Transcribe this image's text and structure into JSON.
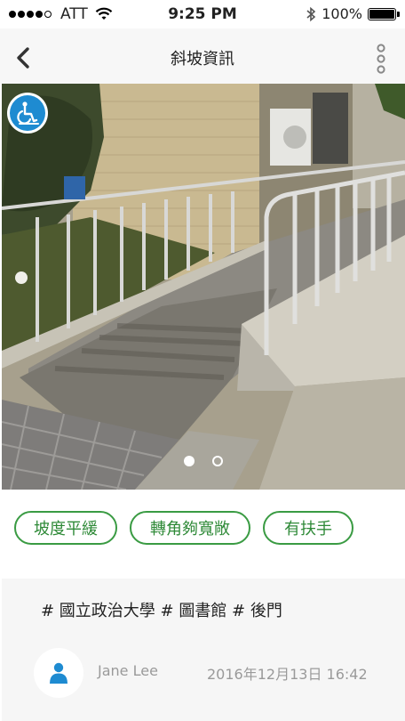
{
  "status_bar": {
    "carrier": "ATT",
    "time": "9:25 PM",
    "battery": "100%",
    "signal_bars": 4,
    "icons": [
      "signal-dots-icon",
      "wifi-icon",
      "bluetooth-icon",
      "battery-icon"
    ]
  },
  "nav": {
    "title": "斜坡資訊",
    "back_icon": "chevron-left-icon",
    "menu_icon": "more-vertical-icon"
  },
  "photo": {
    "badge_icon": "wheelchair-icon",
    "page_count": 2,
    "active_page": 1
  },
  "tags": [
    {
      "label": "坡度平緩"
    },
    {
      "label": "轉角夠寬敞"
    },
    {
      "label": "有扶手"
    }
  ],
  "hashtags": "# 國立政治大學 # 圖書館 # 後門",
  "post": {
    "author": "Jane Lee",
    "timestamp": "2016年12月13日 16:42",
    "avatar_icon": "user-icon"
  },
  "colors": {
    "accent_green": "#3a9b43",
    "badge_blue": "#1e8bd1",
    "avatar_blue": "#1e8bd1"
  }
}
